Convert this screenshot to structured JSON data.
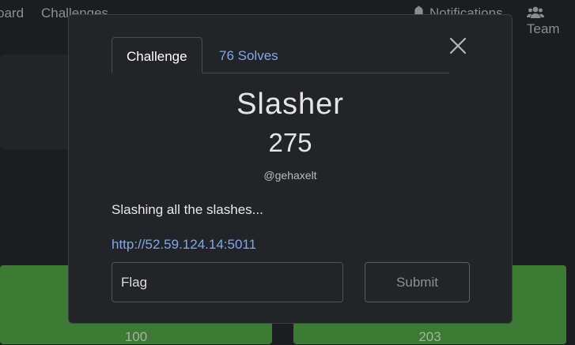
{
  "nav": {
    "scoreboard": "oard",
    "challenges": "Challenges",
    "notifications": "Notifications",
    "team": "Team"
  },
  "tiles": [
    {
      "value": "100"
    },
    {
      "value": "203"
    }
  ],
  "modal": {
    "tabs": {
      "challenge": "Challenge",
      "solves": "76 Solves"
    },
    "name": "Slasher",
    "points": "275",
    "author": "@gehaxelt",
    "description": "Slashing all the slashes...",
    "link": "http://52.59.124.14:5011",
    "flag_placeholder": "Flag",
    "submit_label": "Submit"
  },
  "colors": {
    "background": "#1b1d20",
    "modal": "#222428",
    "link": "#7fa8ea",
    "tile_green": "#3d7a34"
  },
  "icons": {
    "notifications": "bell-icon",
    "team": "users-icon",
    "close": "close-icon"
  }
}
